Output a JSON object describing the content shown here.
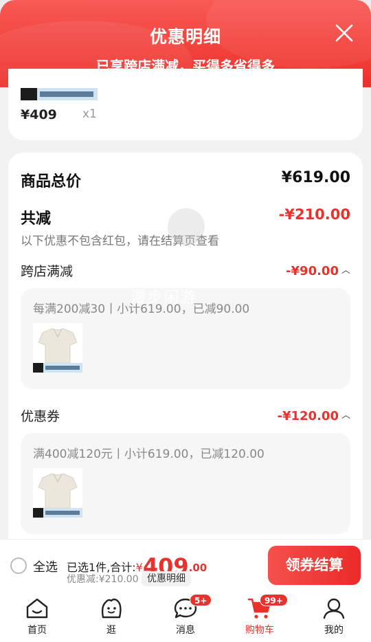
{
  "header": {
    "title": "优惠明细",
    "subtitle": "已享跨店满减，买得多省得多"
  },
  "product_card": {
    "price": "¥409",
    "quantity": "x1"
  },
  "summary_card": {
    "total_label": "商品总价",
    "total_value": "¥619.00",
    "reduce_label": "共减",
    "reduce_value": "-¥210.00",
    "reduce_note": "以下优惠不包含红包，请在结算页查看",
    "cross_store": {
      "label": "跨店满减",
      "value": "-¥90.00",
      "detail": "每满200减30丨小计619.00，已减90.00"
    },
    "coupon": {
      "label": "优惠券",
      "value": "-¥120.00",
      "detail": "满400减120元丨小计619.00，已减120.00"
    },
    "watermark": "漫步闲游"
  },
  "checkout": {
    "select_all": "全选",
    "selected_text": "已选1件,合计:",
    "currency": "¥",
    "total_int": "409",
    "total_dec": ".00",
    "discount_text": "优惠减:¥210.00",
    "detail_button": "优惠明细",
    "pay_button": "领券结算"
  },
  "tabbar": {
    "items": [
      {
        "label": "首页",
        "icon": "home-icon"
      },
      {
        "label": "逛",
        "icon": "browse-icon"
      },
      {
        "label": "消息",
        "icon": "message-icon",
        "badge": "5+"
      },
      {
        "label": "购物车",
        "icon": "cart-icon",
        "badge": "99+",
        "active": true
      },
      {
        "label": "我的",
        "icon": "profile-icon"
      }
    ]
  },
  "colors": {
    "accent": "#e8322d",
    "header": "#f2423c"
  }
}
